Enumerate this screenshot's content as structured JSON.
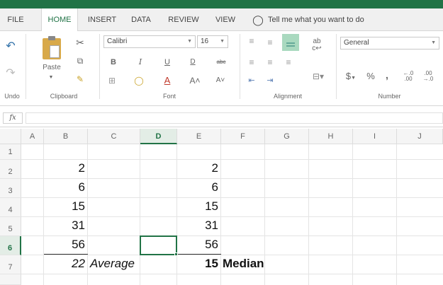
{
  "tabs": [
    {
      "label": "FILE"
    },
    {
      "label": "HOME"
    },
    {
      "label": "INSERT"
    },
    {
      "label": "DATA"
    },
    {
      "label": "REVIEW"
    },
    {
      "label": "VIEW"
    }
  ],
  "tell_me": "Tell me what you want to do",
  "ribbon": {
    "undo_label": "Undo",
    "clipboard_label": "Clipboard",
    "paste_label": "Paste",
    "font_label": "Font",
    "font_name": "Calibri",
    "font_size": "16",
    "bold": "B",
    "italic": "I",
    "underline": "U",
    "alignment_label": "Alignment",
    "number_label": "Number",
    "number_format": "General",
    "currency": "$",
    "percent": "%",
    "comma": ","
  },
  "formula_bar": {
    "fx": "fx",
    "value": ""
  },
  "columns": [
    "A",
    "B",
    "C",
    "D",
    "E",
    "F",
    "G",
    "H",
    "I",
    "J"
  ],
  "rows": [
    "1",
    "2",
    "3",
    "4",
    "5",
    "6",
    "7"
  ],
  "cells": {
    "B2": "2",
    "B3": "6",
    "B4": "15",
    "B5": "31",
    "B6": "56",
    "B7": "22",
    "C7": "Average",
    "E2": "2",
    "E3": "6",
    "E4": "15",
    "E5": "31",
    "E6": "56",
    "E7": "15",
    "F7": "Median"
  },
  "selected_cell": "D6",
  "colors": {
    "accent": "#217346"
  }
}
